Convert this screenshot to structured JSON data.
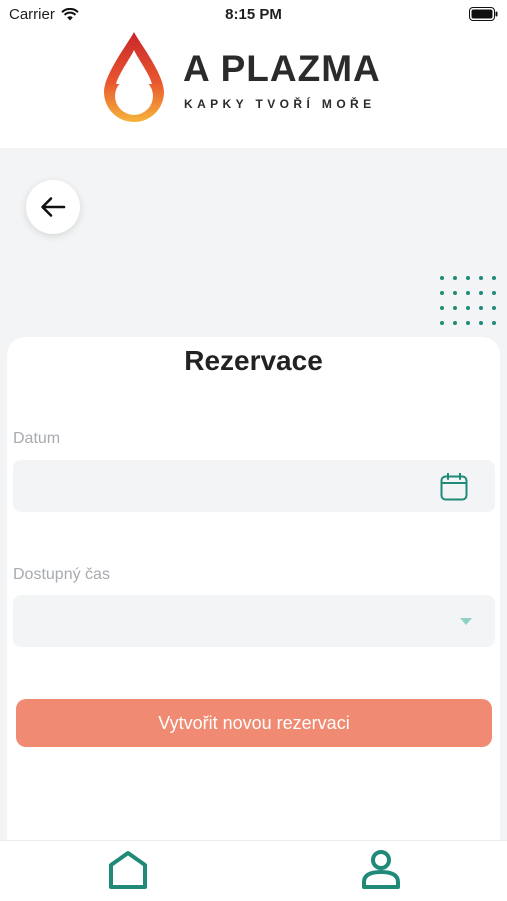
{
  "status_bar": {
    "carrier": "Carrier",
    "time": "8:15 PM"
  },
  "brand": {
    "name": "A PLAZMA",
    "tagline": "KAPKY TVOŘÍ MOŘE"
  },
  "page": {
    "title": "Rezervace"
  },
  "form": {
    "date_label": "Datum",
    "date_value": "",
    "time_label": "Dostupný čas",
    "time_value": ""
  },
  "actions": {
    "create_label": "Vytvořit novou rezervaci"
  },
  "icons": {
    "back": "arrow-left-icon",
    "calendar": "calendar-icon",
    "dropdown": "chevron-down-icon",
    "home": "home-icon",
    "profile": "user-icon"
  },
  "colors": {
    "accent": "#1f8a78",
    "button": "#f08a72",
    "background": "#f3f4f5"
  }
}
